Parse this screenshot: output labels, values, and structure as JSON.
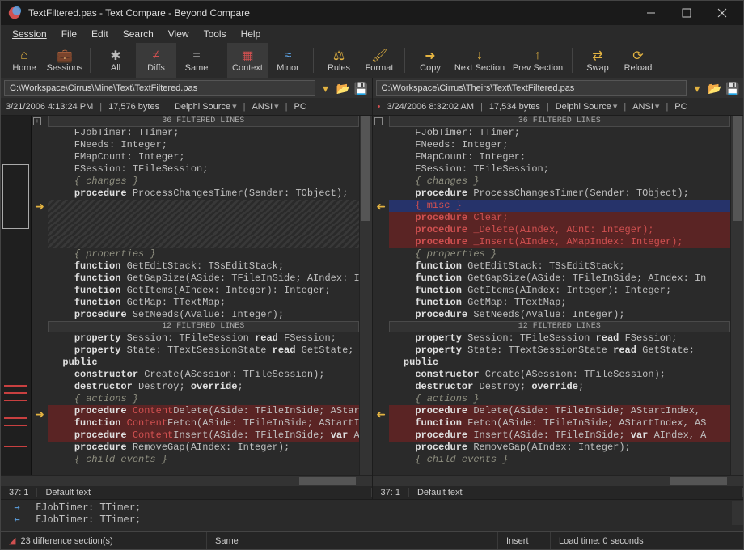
{
  "title": "TextFiltered.pas - Text Compare - Beyond Compare",
  "menu": [
    "Session",
    "File",
    "Edit",
    "Search",
    "View",
    "Tools",
    "Help"
  ],
  "toolbar": {
    "home": "Home",
    "sessions": "Sessions",
    "all": "All",
    "diffs": "Diffs",
    "same": "Same",
    "context": "Context",
    "minor": "Minor",
    "rules": "Rules",
    "format": "Format",
    "copy": "Copy",
    "next": "Next Section",
    "prev": "Prev Section",
    "swap": "Swap",
    "reload": "Reload"
  },
  "left": {
    "path": "C:\\Workspace\\Cirrus\\Mine\\Text\\TextFiltered.pas",
    "date": "3/21/2006 4:13:24 PM",
    "bytes": "17,576 bytes",
    "syntax": "Delphi Source",
    "enc": "ANSI",
    "os": "PC",
    "filt1": "36 FILTERED LINES",
    "filt2": "12 FILTERED LINES",
    "caret": "37: 1",
    "textstyle": "Default text",
    "code1": [
      "    FJobTimer: TTimer;",
      "    FNeeds: Integer;",
      "    FMapCount: Integer;",
      "    FSession: TFileSession;",
      "    { changes }",
      "    procedure ProcessChangesTimer(Sender: TObject);",
      "",
      "",
      "",
      "",
      "    { properties }",
      "    function GetEditStack: TSsEditStack;",
      "    function GetGapSize(ASide: TFileInSide; AIndex: Int",
      "    function GetItems(AIndex: Integer): Integer;",
      "    function GetMap: TTextMap;",
      "    procedure SetNeeds(AValue: Integer);"
    ],
    "code2": [
      "    property Session: TFileSession read FSession;",
      "    property State: TTextSessionState read GetState;",
      "  public",
      "    constructor Create(ASession: TFileSession);",
      "    destructor Destroy; override;",
      "    { actions }",
      "    procedure ContentDelete(ASide: TFileInSide; AStartIn",
      "    function ContentFetch(ASide: TFileInSide; AStartIn",
      "    procedure ContentInsert(ASide: TFileInSide; var AI",
      "    procedure RemoveGap(AIndex: Integer);",
      "    { child events }"
    ]
  },
  "right": {
    "path": "C:\\Workspace\\Cirrus\\Theirs\\Text\\TextFiltered.pas",
    "date": "3/24/2006 8:32:02 AM",
    "bytes": "17,534 bytes",
    "syntax": "Delphi Source",
    "enc": "ANSI",
    "os": "PC",
    "filt1": "36 FILTERED LINES",
    "filt2": "12 FILTERED LINES",
    "caret": "37: 1",
    "textstyle": "Default text",
    "code1": [
      "    FJobTimer: TTimer;",
      "    FNeeds: Integer;",
      "    FMapCount: Integer;",
      "    FSession: TFileSession;",
      "    { changes }",
      "    procedure ProcessChangesTimer(Sender: TObject);",
      "    { misc }",
      "    procedure Clear;",
      "    procedure _Delete(AIndex, ACnt: Integer);",
      "    procedure _Insert(AIndex, AMapIndex: Integer);",
      "    { properties }",
      "    function GetEditStack: TSsEditStack;",
      "    function GetGapSize(ASide: TFileInSide; AIndex: In",
      "    function GetItems(AIndex: Integer): Integer;",
      "    function GetMap: TTextMap;",
      "    procedure SetNeeds(AValue: Integer);"
    ],
    "code2": [
      "    property Session: TFileSession read FSession;",
      "    property State: TTextSessionState read GetState;",
      "  public",
      "    constructor Create(ASession: TFileSession);",
      "    destructor Destroy; override;",
      "    { actions }",
      "    procedure Delete(ASide: TFileInSide; AStartIndex, ",
      "    function Fetch(ASide: TFileInSide; AStartIndex, AS",
      "    procedure Insert(ASide: TFileInSide; var AIndex, A",
      "    procedure RemoveGap(AIndex: Integer);",
      "    { child events }"
    ]
  },
  "merge": {
    "rows": [
      "    FJobTimer: TTimer;",
      "    FJobTimer: TTimer;"
    ]
  },
  "status": {
    "diffs": "23 difference section(s)",
    "same": "Same",
    "ins": "Insert",
    "load": "Load time: 0 seconds"
  }
}
